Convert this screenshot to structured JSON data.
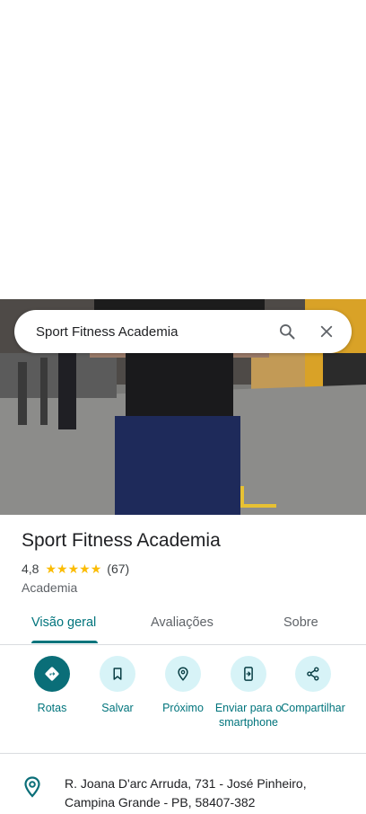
{
  "search": {
    "query": "Sport Fitness Academia"
  },
  "place": {
    "name": "Sport Fitness Academia",
    "rating": "4,8",
    "rating_value": 4.8,
    "review_count": "(67)",
    "category": "Academia",
    "address": "R. Joana D'arc Arruda, 731 - José Pinheiro, Campina Grande - PB, 58407-382"
  },
  "tabs": [
    {
      "label": "Visão geral",
      "active": true
    },
    {
      "label": "Avaliações",
      "active": false
    },
    {
      "label": "Sobre",
      "active": false
    }
  ],
  "actions": [
    {
      "label": "Rotas",
      "icon": "directions-icon"
    },
    {
      "label": "Salvar",
      "icon": "bookmark-icon"
    },
    {
      "label": "Próximo",
      "icon": "nearby-icon"
    },
    {
      "label": "Enviar para o smartphone",
      "icon": "send-to-phone-icon"
    },
    {
      "label": "Compartilhar",
      "icon": "share-icon"
    }
  ],
  "colors": {
    "accent": "#00747c",
    "primary_action": "#0a6e78",
    "action_bg": "#d7f3f7",
    "star": "#fbbc04"
  }
}
